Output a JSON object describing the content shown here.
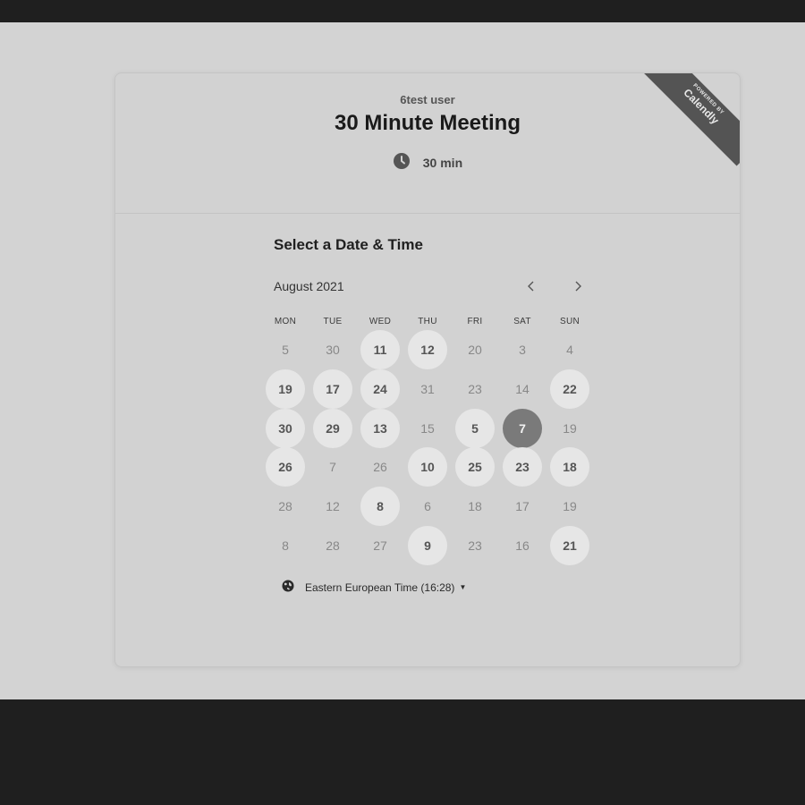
{
  "event": {
    "host_name": "6test user",
    "title": "30 Minute Meeting",
    "duration": "30 min"
  },
  "branding": {
    "powered_by": "POWERED BY",
    "brand": "Calendly"
  },
  "calendar": {
    "section_title": "Select a Date & Time",
    "month_label": "August 2021",
    "weekdays": [
      "MON",
      "TUE",
      "WED",
      "THU",
      "FRI",
      "SAT",
      "SUN"
    ],
    "selected_day": "7",
    "weeks": [
      [
        {
          "label": "5",
          "state": "disabled"
        },
        {
          "label": "30",
          "state": "disabled"
        },
        {
          "label": "11",
          "state": "available"
        },
        {
          "label": "12",
          "state": "available"
        },
        {
          "label": "20",
          "state": "disabled"
        },
        {
          "label": "3",
          "state": "disabled"
        },
        {
          "label": "4",
          "state": "disabled"
        }
      ],
      [
        {
          "label": "19",
          "state": "available"
        },
        {
          "label": "17",
          "state": "available"
        },
        {
          "label": "24",
          "state": "available"
        },
        {
          "label": "31",
          "state": "disabled"
        },
        {
          "label": "23",
          "state": "disabled"
        },
        {
          "label": "14",
          "state": "disabled"
        },
        {
          "label": "22",
          "state": "available"
        }
      ],
      [
        {
          "label": "30",
          "state": "available"
        },
        {
          "label": "29",
          "state": "available"
        },
        {
          "label": "13",
          "state": "available"
        },
        {
          "label": "15",
          "state": "disabled"
        },
        {
          "label": "5",
          "state": "available"
        },
        {
          "label": "7",
          "state": "selected"
        },
        {
          "label": "19",
          "state": "disabled"
        }
      ],
      [
        {
          "label": "26",
          "state": "available"
        },
        {
          "label": "7",
          "state": "disabled"
        },
        {
          "label": "26",
          "state": "disabled"
        },
        {
          "label": "10",
          "state": "available"
        },
        {
          "label": "25",
          "state": "available"
        },
        {
          "label": "23",
          "state": "available"
        },
        {
          "label": "18",
          "state": "available"
        }
      ],
      [
        {
          "label": "28",
          "state": "disabled"
        },
        {
          "label": "12",
          "state": "disabled"
        },
        {
          "label": "8",
          "state": "available"
        },
        {
          "label": "6",
          "state": "disabled"
        },
        {
          "label": "18",
          "state": "disabled"
        },
        {
          "label": "17",
          "state": "disabled"
        },
        {
          "label": "19",
          "state": "disabled"
        }
      ],
      [
        {
          "label": "8",
          "state": "disabled"
        },
        {
          "label": "28",
          "state": "disabled"
        },
        {
          "label": "27",
          "state": "disabled"
        },
        {
          "label": "9",
          "state": "available"
        },
        {
          "label": "23",
          "state": "disabled"
        },
        {
          "label": "16",
          "state": "disabled"
        },
        {
          "label": "21",
          "state": "available"
        }
      ]
    ]
  },
  "timezone": {
    "label": "Eastern European Time (16:28)"
  },
  "icons": {
    "clock": "clock-icon",
    "globe": "globe-icon",
    "prev": "chevron-left-icon",
    "next": "chevron-right-icon",
    "caret": "caret-down-icon"
  },
  "colors": {
    "page_background": "#1f1f1f",
    "viewport_background": "#d3d3d3",
    "available_day": "#e6e6e6",
    "selected_day": "#7a7a7a",
    "ribbon": "#545454"
  }
}
